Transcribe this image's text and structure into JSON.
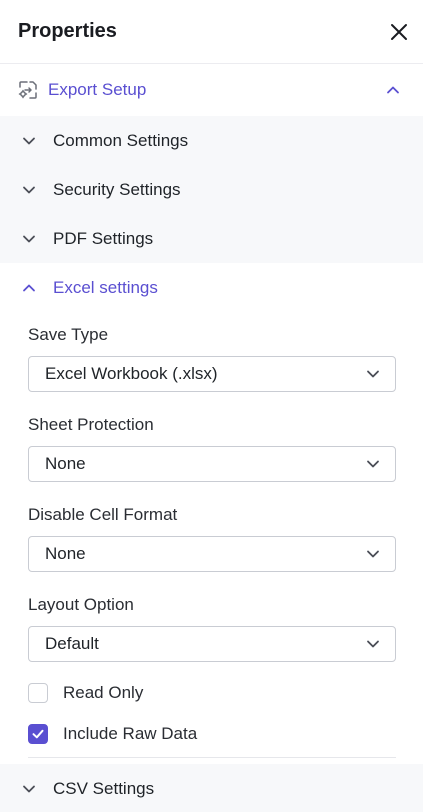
{
  "header": {
    "title": "Properties"
  },
  "export_setup": {
    "label": "Export Setup"
  },
  "sections": {
    "common": "Common Settings",
    "security": "Security Settings",
    "pdf": "PDF Settings",
    "excel": "Excel settings",
    "csv": "CSV Settings"
  },
  "excel": {
    "save_type": {
      "label": "Save Type",
      "value": "Excel Workbook (.xlsx)"
    },
    "sheet_protection": {
      "label": "Sheet Protection",
      "value": "None"
    },
    "disable_cell_format": {
      "label": "Disable Cell Format",
      "value": "None"
    },
    "layout_option": {
      "label": "Layout Option",
      "value": "Default"
    },
    "read_only": {
      "label": "Read Only",
      "checked": false
    },
    "include_raw_data": {
      "label": "Include Raw Data",
      "checked": true
    }
  },
  "colors": {
    "accent": "#5a4fd1",
    "section_bg": "#f7f8fa",
    "border": "#c9ccd3"
  }
}
